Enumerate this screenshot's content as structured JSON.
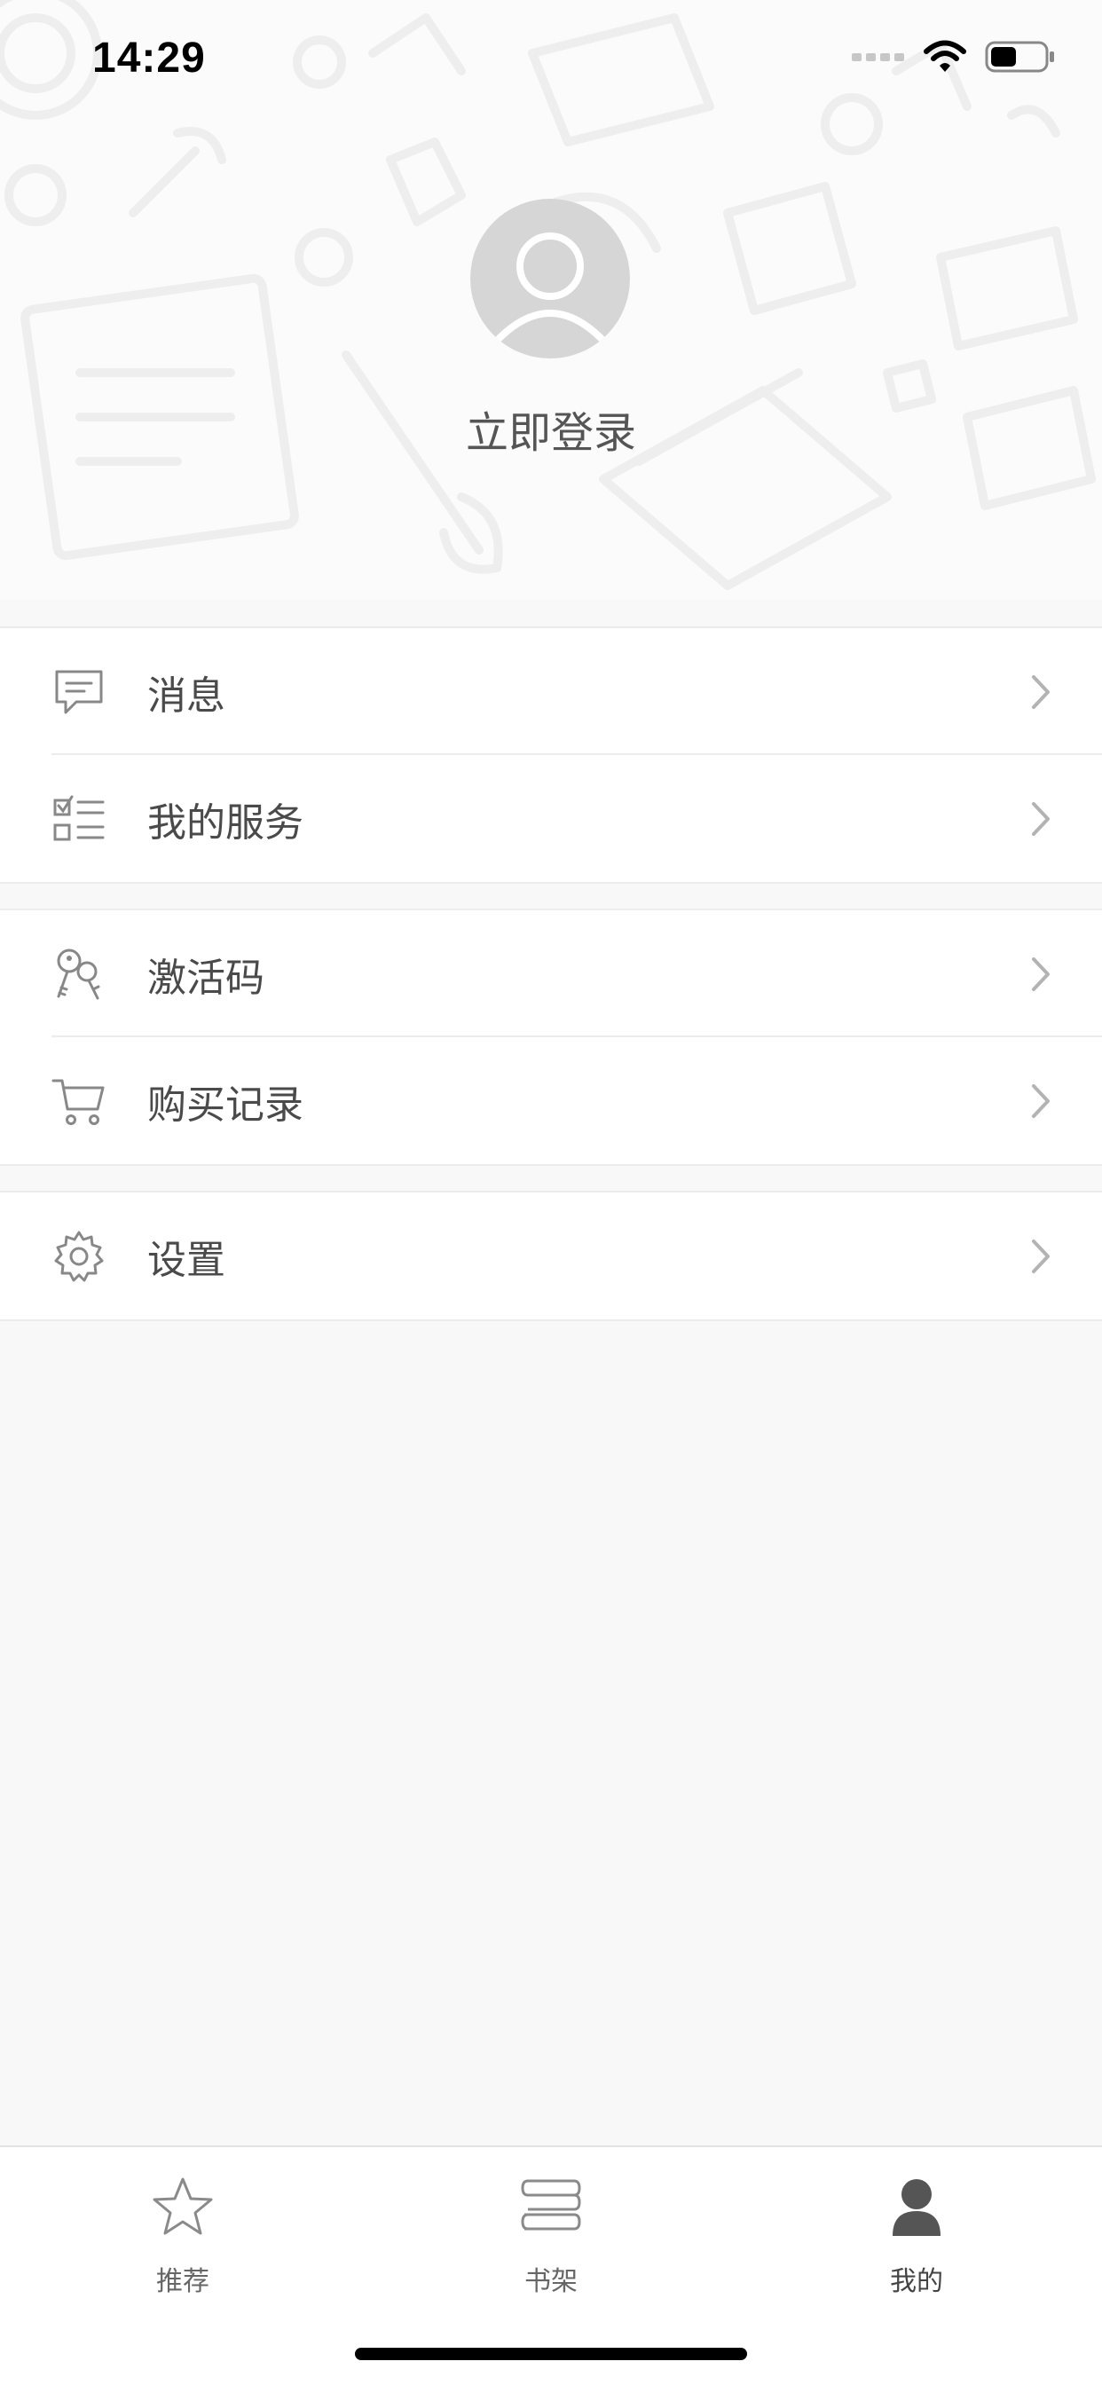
{
  "status_bar": {
    "time": "14:29"
  },
  "profile": {
    "login_text": "立即登录"
  },
  "menu": {
    "groups": [
      {
        "items": [
          {
            "label": "消息",
            "icon": "message-icon"
          },
          {
            "label": "我的服务",
            "icon": "checklist-icon"
          }
        ]
      },
      {
        "items": [
          {
            "label": "激活码",
            "icon": "keys-icon"
          },
          {
            "label": "购买记录",
            "icon": "cart-icon"
          }
        ]
      },
      {
        "items": [
          {
            "label": "设置",
            "icon": "gear-icon"
          }
        ]
      }
    ]
  },
  "tabbar": {
    "tabs": [
      {
        "label": "推荐",
        "icon": "star-icon",
        "active": false
      },
      {
        "label": "书架",
        "icon": "bookshelf-icon",
        "active": false
      },
      {
        "label": "我的",
        "icon": "person-icon",
        "active": true
      }
    ]
  },
  "colors": {
    "background": "#f8f8f8",
    "avatar": "#d6d6d6",
    "text": "#4a4a4a",
    "divider": "#ececec"
  }
}
